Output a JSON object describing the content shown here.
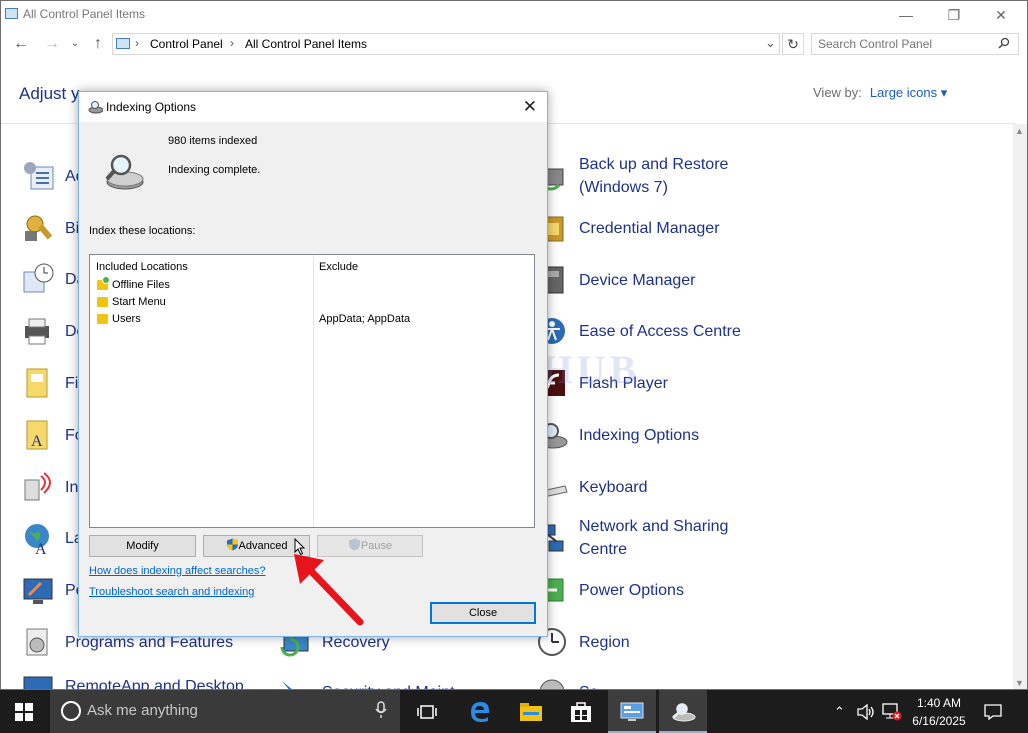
{
  "window": {
    "title": "All Control Panel Items",
    "minimize": "—",
    "maximize": "❐",
    "close": "✕"
  },
  "nav": {
    "back": "←",
    "forward": "→",
    "up": "↑",
    "breadcrumb": [
      "Control Panel",
      "All Control Panel Items"
    ],
    "separator": "›",
    "dropdown": "⌄",
    "refresh": "↻",
    "search_placeholder": "Search Control Panel"
  },
  "main": {
    "heading": "Adjust y",
    "heading_tail": "",
    "view_by_label": "View by:",
    "view_by_value": "Large icons ▾"
  },
  "items_left": [
    {
      "label": "Ac",
      "icon": "action-center-icon"
    },
    {
      "label": "Bi",
      "icon": "bitlocker-icon"
    },
    {
      "label": "Da",
      "icon": "date-time-icon"
    },
    {
      "label": "De",
      "icon": "devices-printers-icon"
    },
    {
      "label": "Fi",
      "icon": "file-history-icon"
    },
    {
      "label": "Fo",
      "icon": "fonts-icon"
    },
    {
      "label": "In",
      "icon": "internet-options-icon"
    },
    {
      "label": "La",
      "icon": "language-icon"
    },
    {
      "label": "Pe",
      "icon": "personalization-icon"
    },
    {
      "label": "Programs and Features",
      "icon": "programs-features-icon"
    },
    {
      "label": "RemoteApp and Desktop",
      "icon": "remoteapp-icon"
    }
  ],
  "items_mid": [
    {
      "label": "Recovery",
      "icon": "recovery-icon"
    },
    {
      "label": "Security and Maint",
      "icon": "security-maintenance-icon"
    }
  ],
  "items_right": [
    {
      "label": "Back up and Restore (Windows 7)",
      "line1": "Back up and Restore",
      "line2": "(Windows 7)",
      "icon": "backup-restore-icon"
    },
    {
      "label": "Credential Manager",
      "icon": "credential-manager-icon"
    },
    {
      "label": "Device Manager",
      "icon": "device-manager-icon"
    },
    {
      "label": "Ease of Access Centre",
      "icon": "ease-of-access-icon"
    },
    {
      "label": "Flash Player",
      "icon": "flash-player-icon"
    },
    {
      "label": "Indexing Options",
      "icon": "indexing-options-icon"
    },
    {
      "label": "Keyboard",
      "icon": "keyboard-icon"
    },
    {
      "label": "Network and Sharing Centre",
      "line1": "Network and Sharing",
      "line2": "Centre",
      "icon": "network-sharing-icon"
    },
    {
      "label": "Power Options",
      "icon": "power-options-icon"
    },
    {
      "label": "Region",
      "icon": "region-icon"
    },
    {
      "label": "So",
      "icon": "sound-icon"
    }
  ],
  "watermark": "IT Pros HUB",
  "dialog": {
    "title": "Indexing Options",
    "close": "✕",
    "items_indexed": "980 items indexed",
    "status": "Indexing complete.",
    "index_label": "Index these locations:",
    "columns": [
      "Included Locations",
      "Exclude"
    ],
    "rows": [
      {
        "location": "Offline Files",
        "exclude": ""
      },
      {
        "location": "Start Menu",
        "exclude": ""
      },
      {
        "location": "Users",
        "exclude": "AppData; AppData"
      }
    ],
    "buttons": {
      "modify": "Modify",
      "advanced": "Advanced",
      "pause": "Pause",
      "close": "Close"
    },
    "links": {
      "how": "How does indexing affect searches?",
      "troubleshoot": "Troubleshoot search and indexing"
    }
  },
  "taskbar": {
    "search_text": "Ask me anything",
    "clock_time": "1:40 AM",
    "clock_date": "6/16/2025",
    "tray_chevron": "⌃",
    "tray_volume": "🔈",
    "notifications": "☐"
  },
  "colors": {
    "link_blue": "#1e3287",
    "accent": "#0078d7",
    "annotation_arrow": "#e8141b",
    "taskbar": "#1c1c1c"
  }
}
